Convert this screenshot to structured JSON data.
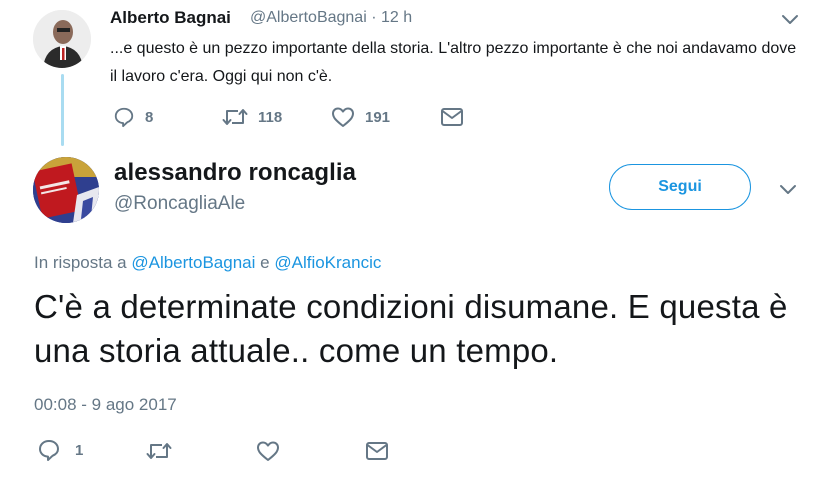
{
  "parent_tweet": {
    "author_name": "Alberto Bagnai",
    "author_handle_time": "@AlbertoBagnai · 12 h",
    "text": "...e questo è un pezzo importante della storia. L'altro pezzo importante è che noi andavamo dove il lavoro c'era. Oggi qui non c'è.",
    "actions": {
      "reply_count": "8",
      "retweet_count": "118",
      "like_count": "191"
    }
  },
  "main_tweet": {
    "author_name": "alessandro roncaglia",
    "author_handle": "@RoncagliaAle",
    "follow_label": "Segui",
    "reply_to_prefix": "In risposta a",
    "reply_to_user1": "@AlbertoBagnai",
    "reply_to_conj": "e",
    "reply_to_user2": "@AlfioKrancic",
    "text": "C'è a determinate condizioni disumane. E questa è una storia attuale.. come un tempo.",
    "timestamp": "00:08 - 9 ago 2017",
    "actions": {
      "reply_count": "1"
    }
  },
  "colors": {
    "accent": "#1b95e0",
    "muted": "#657786",
    "thread_line": "#a9dcf1"
  },
  "icons": [
    "reply-icon",
    "retweet-icon",
    "like-icon",
    "message-icon",
    "chevron-down-icon"
  ]
}
